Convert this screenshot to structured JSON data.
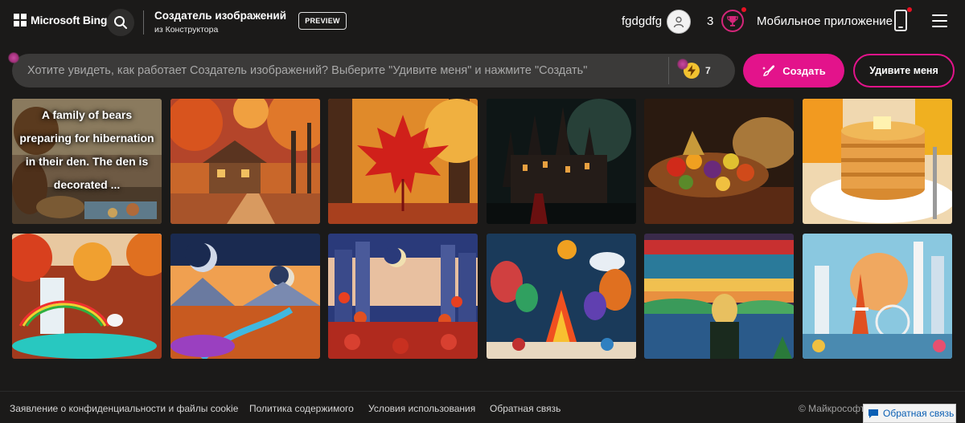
{
  "header": {
    "brand": "Microsoft Bing",
    "product_title": "Создатель изображений",
    "product_subtitle": "из Конструктора",
    "preview_badge": "PREVIEW",
    "username": "fgdgdfg",
    "rewards_count": "3",
    "mobile_app_label": "Мобильное приложение"
  },
  "prompt": {
    "placeholder": "Хотите увидеть, как работает Создатель изображений? Выберите \"Удивите меня\" и нажмите \"Создать\"",
    "boost_count": "7",
    "create_label": "Создать",
    "surprise_label": "Удивите меня"
  },
  "gallery": {
    "row1": [
      {
        "caption": "A family of bears preparing for hibernation in their den. The den is decorated ...",
        "icon": "bears-image"
      },
      {
        "caption": "",
        "icon": "autumn-cabin-image"
      },
      {
        "caption": "",
        "icon": "red-maple-leaf-image"
      },
      {
        "caption": "",
        "icon": "dark-castle-image"
      },
      {
        "caption": "",
        "icon": "cornucopia-image"
      },
      {
        "caption": "",
        "icon": "pancakes-image"
      }
    ],
    "row2": [
      {
        "caption": "",
        "icon": "waterfall-rainbow-image"
      },
      {
        "caption": "",
        "icon": "moons-autumn-valley-image"
      },
      {
        "caption": "",
        "icon": "lantern-festival-city-image"
      },
      {
        "caption": "",
        "icon": "felt-campfire-image"
      },
      {
        "caption": "",
        "icon": "woman-at-lake-image"
      },
      {
        "caption": "",
        "icon": "papercraft-tokyo-image"
      }
    ]
  },
  "footer": {
    "links": [
      "Заявление о конфиденциальности и файлы cookie",
      "Политика содержимого",
      "Условия использования",
      "Обратная связь"
    ],
    "copyright": "© Майкрософт",
    "feedback_button": "Обратная связь"
  },
  "colors": {
    "background": "#1b1a19",
    "accent": "#e3138b",
    "prompt_bg": "#3b3a39",
    "boost": "#f2c230"
  }
}
